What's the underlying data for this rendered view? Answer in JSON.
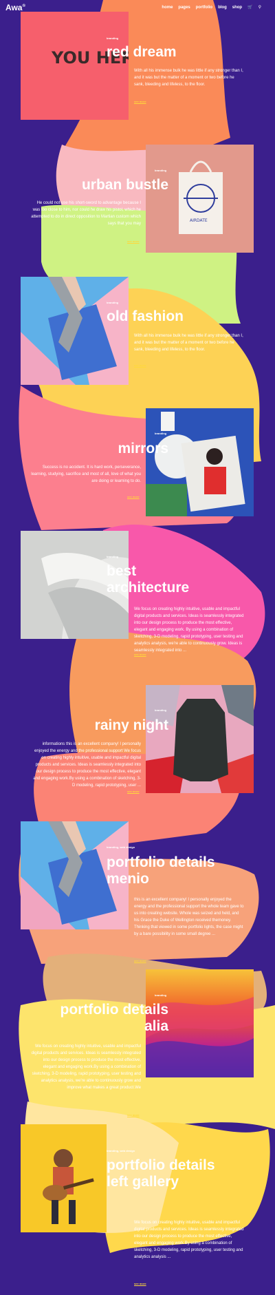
{
  "header": {
    "logo": "Awa",
    "logo_sup": "®",
    "nav": [
      "home",
      "pages",
      "portfolio",
      "blog",
      "shop"
    ],
    "cart_icon": "cart-icon",
    "search_icon": "search-icon"
  },
  "more_label": "see more",
  "items": [
    {
      "category": "branding",
      "title": "red dream",
      "desc": "With all his immense bulk he was little if any stronger than I, and it was but the matter of a moment or two before he sank, bleeding and lifeless, to the floor.",
      "image_text": "YOU HERE"
    },
    {
      "category": "branding",
      "title": "urban bustle",
      "desc": "He could not use his short-sword to advantage because I was too close to him, nor could he draw his pistol, which he attempted to do in direct opposition to Martian custom which says that you may",
      "image_text": "AIRDATE"
    },
    {
      "category": "branding",
      "title": "old fashion",
      "desc": "With all his immense bulk he was little if any stronger than I, and it was but the matter of a moment or two before he sank, bleeding and lifeless, to the floor."
    },
    {
      "category": "branding",
      "title": "mirrors",
      "desc": "Success is no accident. It is hard work, perseverance, learning, studying, sacrifice and most of all, love of what you are doing or learning to do."
    },
    {
      "category": "branding",
      "title": "best architecture",
      "desc": "We focus on creating highly intuitive, usable and impactful digital products and services. Ideas is seamlessly integrated into our design process to produce the most effective, elegant and engaging work. By using a combination of sketching, 3-D modeling, rapid prototyping, user testing and analytics analysis, we're able to continuously grow. Ideas is seamlessly integrated into ..."
    },
    {
      "category": "branding",
      "title": "rainy night",
      "desc": "informations this is an excellent company! I personally enjoyed the energy and the professional support We focus on creating highly intuitive, usable and impactful digital products and services. Ideas is seamlessly integrated into our design process to produce the most effective, elegant and engaging work.By using a combination of sketching, 3-D modeling, rapid prototyping, user ..."
    },
    {
      "category": "branding, web design",
      "title": "portfolio details menio",
      "desc": "this is an excellent company! I personally enjoyed the energy and the professional support the whole team gave to us into creating website. Whole was seized and held, and his Grace the Duke of Wellington received themoney. Thinking that viewed in some portfolio lights, the case might by a bare possibility in some small degree ..."
    },
    {
      "category": "branding",
      "title": "portfolio details alia",
      "desc": "We focus on creating highly intuitive, usable and impactful digital products and services. Ideas is seamlessly integrated into our design process to produce the most effective, elegant and engaging work.By using a combination of sketching, 3-D modeling, rapid prototyping, user testing and analytics analysis, we're able to continuously grow and improve what makes a great product.We"
    },
    {
      "category": "branding, web design",
      "title": "portfolio details left gallery",
      "desc": "We focus on creating highly intuitive, usable and impactful digital products and services. Ideas is seamlessly integrated into our design process to produce the most effective, elegant and engaging work.By using a combination of sketching, 3-D modeling, rapid prototyping, user testing and analytics analysis ..."
    }
  ]
}
